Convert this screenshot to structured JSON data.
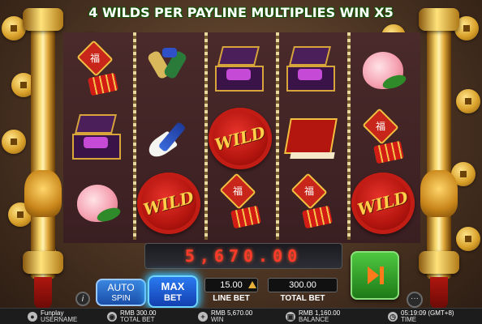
{
  "banner": {
    "text": "4 WILDS PER PAYLINE MULTIPLIES WIN X5"
  },
  "reels": {
    "wild_label": "WILD",
    "talisman_char": "福"
  },
  "win": {
    "amount": "5,670.00"
  },
  "controls": {
    "info_label": "i",
    "more_label": "···",
    "auto_spin_line1": "AUTO",
    "auto_spin_line2": "SPIN",
    "max_bet_line1": "MAX",
    "max_bet_line2": "BET",
    "line_bet_value": "15.00",
    "line_bet_label": "LINE BET",
    "total_bet_value": "300.00",
    "total_bet_label": "TOTAL BET",
    "spin_icon": "play-skip-icon"
  },
  "footer": {
    "username_value": "Funplay",
    "username_label": "USERNAME",
    "total_bet_value": "RMB 300.00",
    "total_bet_label": "TOTAL BET",
    "win_value": "RMB 5,670.00",
    "win_label": "WIN",
    "balance_value": "RMB 1,160.00",
    "balance_label": "BALANCE",
    "time_value": "05:19:09 (GMT+8)",
    "time_label": "TIME"
  }
}
